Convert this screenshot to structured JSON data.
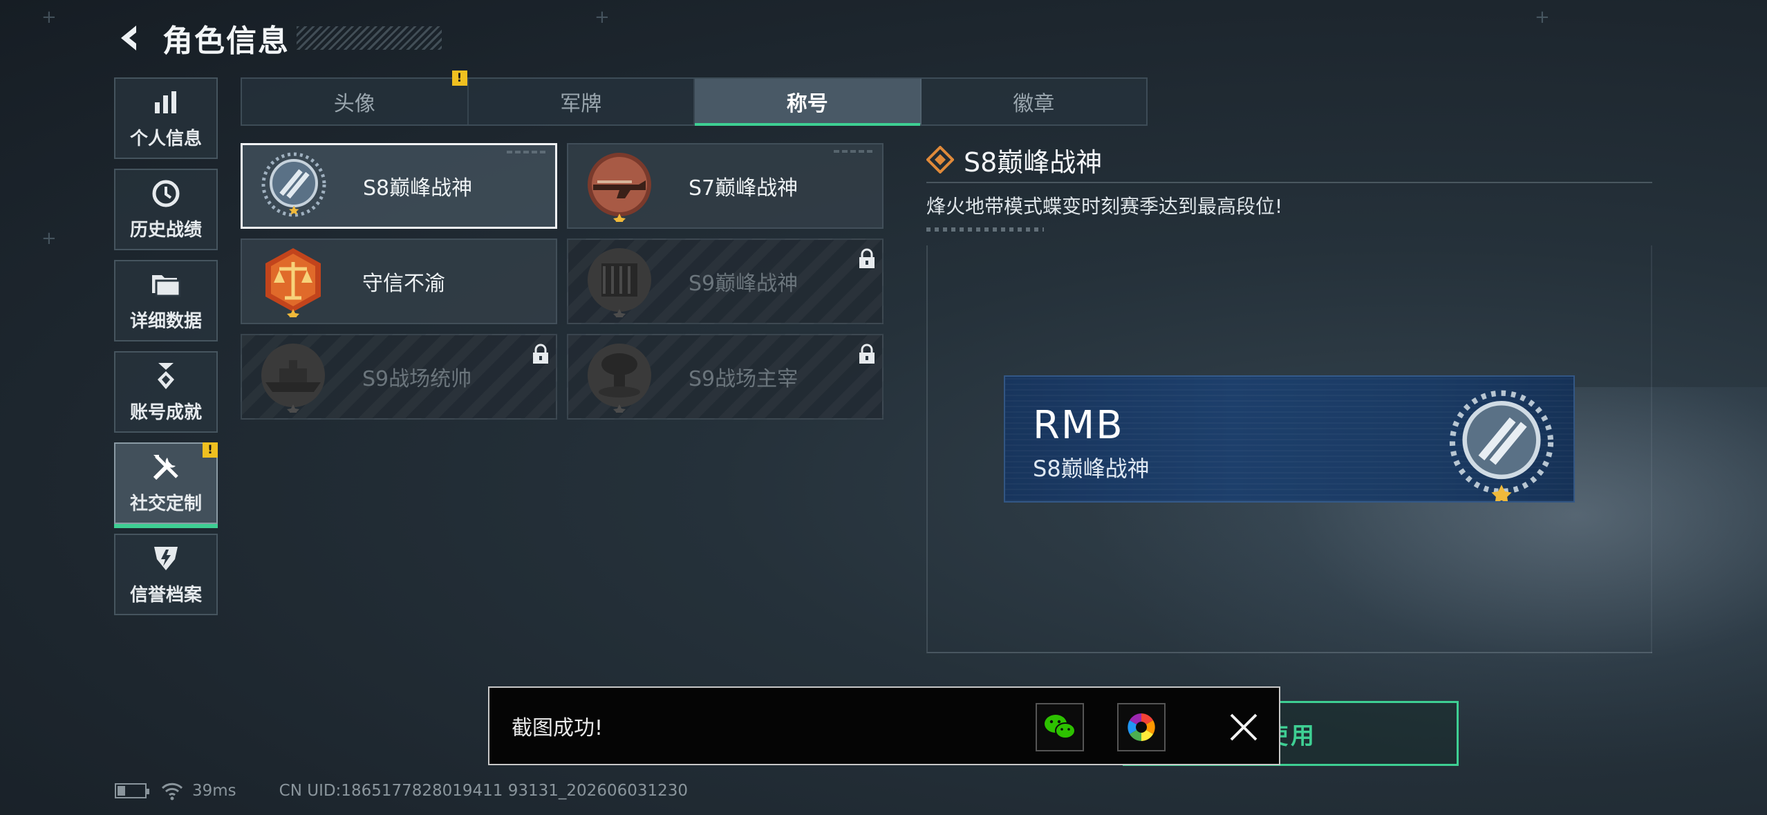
{
  "header": {
    "title": "角色信息"
  },
  "sidebar": {
    "items": [
      {
        "label": "个人信息",
        "icon": "bar-chart-icon"
      },
      {
        "label": "历史战绩",
        "icon": "clock-icon"
      },
      {
        "label": "详细数据",
        "icon": "folder-icon"
      },
      {
        "label": "账号成就",
        "icon": "medal-icon"
      },
      {
        "label": "社交定制",
        "icon": "tools-icon",
        "active": true,
        "warning": "!"
      },
      {
        "label": "信誉档案",
        "icon": "shield-icon"
      }
    ]
  },
  "tabs": [
    {
      "label": "头像",
      "warning": "!"
    },
    {
      "label": "军牌"
    },
    {
      "label": "称号",
      "active": true
    },
    {
      "label": "徽章"
    }
  ],
  "titles": [
    {
      "label": "S8巅峰战神",
      "selected": true,
      "locked": false
    },
    {
      "label": "S7巅峰战神",
      "selected": false,
      "locked": false
    },
    {
      "label": "守信不渝",
      "selected": false,
      "locked": false
    },
    {
      "label": "S9巅峰战神",
      "selected": false,
      "locked": true
    },
    {
      "label": "S9战场统帅",
      "selected": false,
      "locked": true
    },
    {
      "label": "S9战场主宰",
      "selected": false,
      "locked": true
    }
  ],
  "detail": {
    "title": "S8巅峰战神",
    "description": "烽火地带模式蝶变时刻赛季达到最高段位!"
  },
  "preview": {
    "player_name": "RMB",
    "title": "S8巅峰战神"
  },
  "use_button": {
    "label": "使用"
  },
  "toast": {
    "message": "截图成功!",
    "share_wechat": "wechat-icon",
    "share_album": "album-icon",
    "close": "close-icon"
  },
  "footer": {
    "ping": "39ms",
    "uid": "CN UID:1865177828019411 93131_202606031230"
  },
  "colors": {
    "accent": "#3ecf93",
    "warning": "#f0c020",
    "banner": "#1d3f6b",
    "background": "#1d262e"
  }
}
